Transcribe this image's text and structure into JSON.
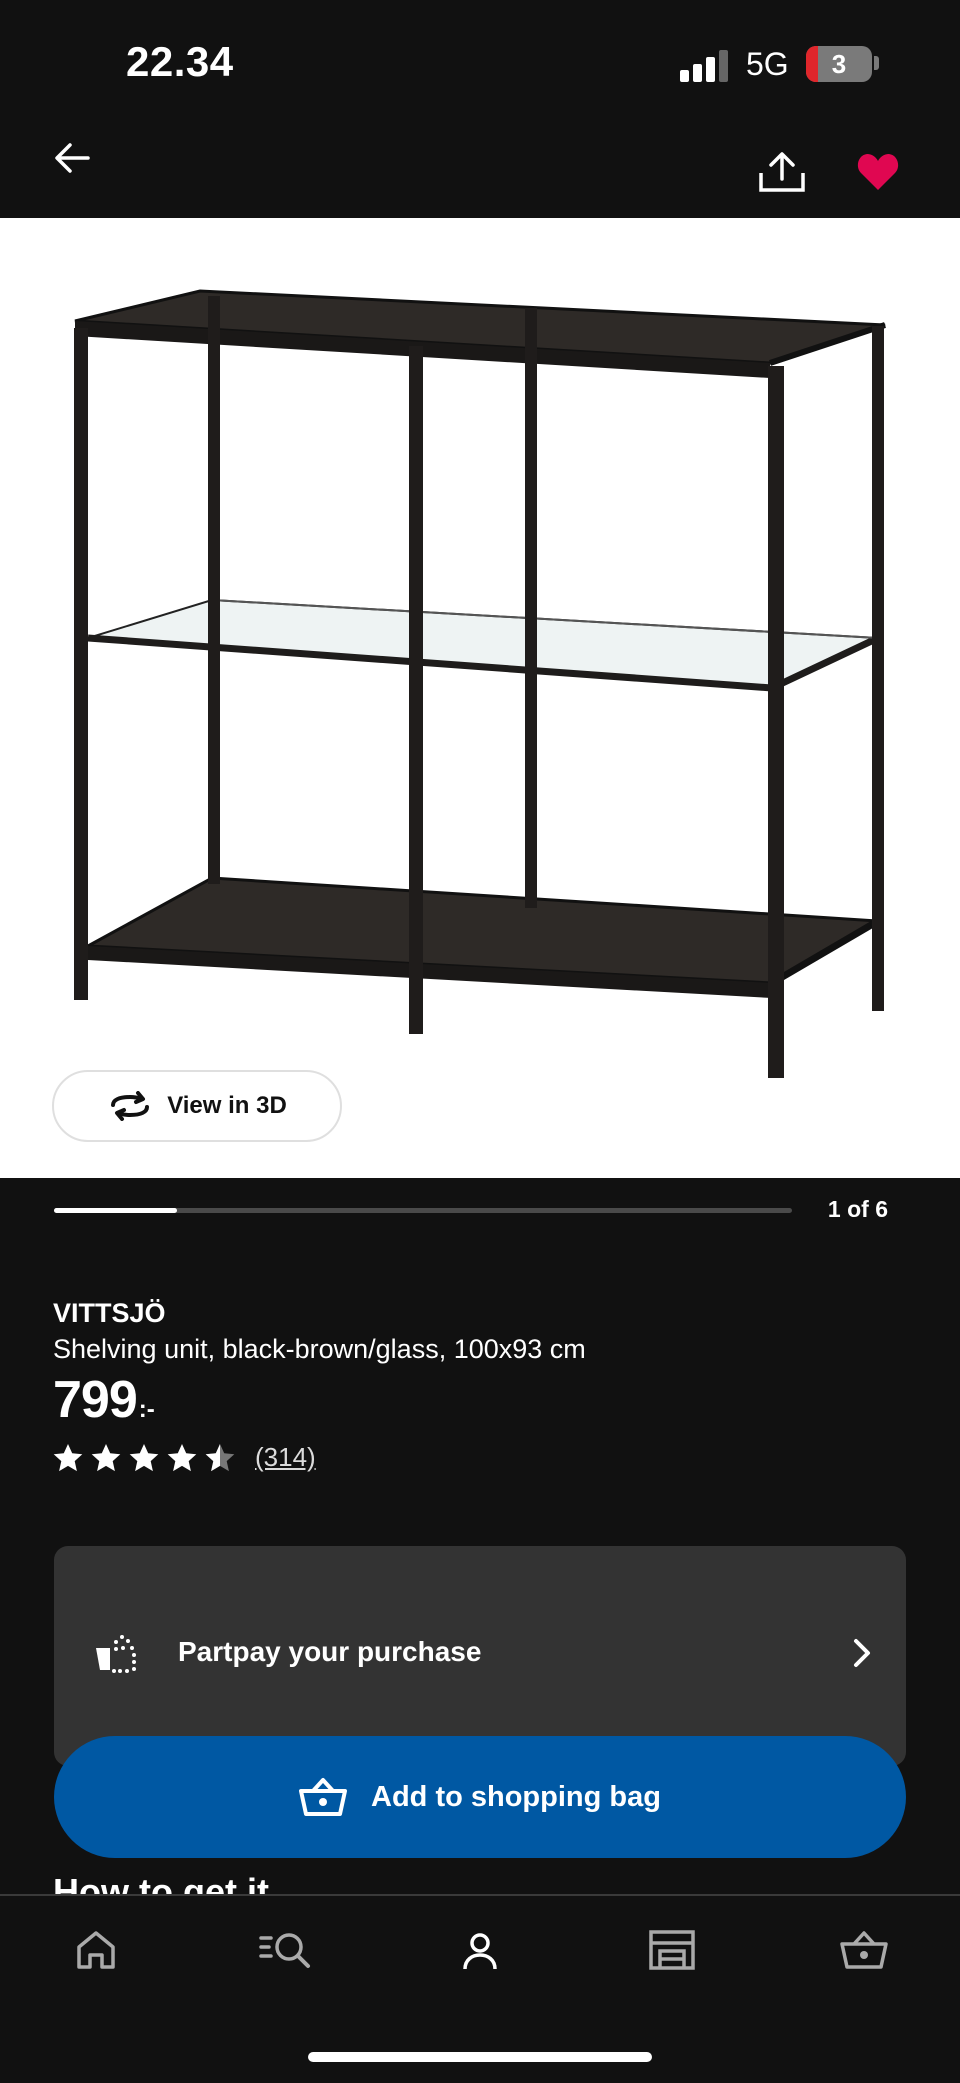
{
  "status_bar": {
    "time": "22.34",
    "network": "5G",
    "battery_level": "3"
  },
  "header": {
    "back_icon": "arrow-left-icon",
    "share_icon": "share-upload-icon",
    "favorite_icon": "heart-filled-icon",
    "favorite_color": "#e00751"
  },
  "gallery": {
    "view_3d_label": "View in 3D",
    "view_3d_icon": "rotate-3d-icon",
    "counter": "1 of 6",
    "progress": 0.166
  },
  "product": {
    "name": "VITTSJÖ",
    "description": "Shelving unit, black-brown/glass, 100x93 cm",
    "price": "799",
    "price_suffix": ":-",
    "rating": 4.5,
    "rating_max": 5,
    "review_count": "(314)"
  },
  "partpay": {
    "label": "Partpay your purchase",
    "icon": "partpay-icon"
  },
  "cart": {
    "add_label": "Add to shopping bag",
    "icon": "basket-icon",
    "button_color": "#0058a3"
  },
  "section": {
    "how_to_get_title": "How to get it"
  },
  "tab_bar": {
    "tabs": [
      {
        "icon": "home-icon"
      },
      {
        "icon": "search-list-icon"
      },
      {
        "icon": "profile-icon"
      },
      {
        "icon": "store-icon"
      },
      {
        "icon": "basket-icon"
      }
    ]
  }
}
